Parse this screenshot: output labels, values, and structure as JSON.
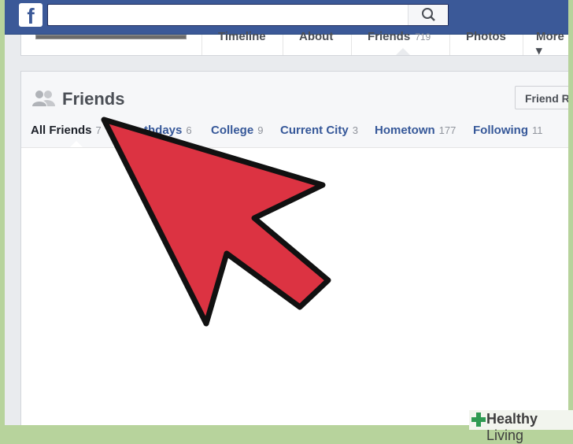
{
  "topbar": {
    "logo": "f",
    "search_placeholder": "",
    "search_icon": "search-icon"
  },
  "profile_nav": {
    "items": [
      {
        "label": "Timeline",
        "count": ""
      },
      {
        "label": "About",
        "count": ""
      },
      {
        "label": "Friends",
        "count": "719"
      },
      {
        "label": "Photos",
        "count": ""
      },
      {
        "label": "More",
        "count": ""
      }
    ]
  },
  "friends_panel": {
    "title": "Friends",
    "friend_requests_button": "Friend R",
    "tabs": [
      {
        "label": "All Friends",
        "count": "7"
      },
      {
        "label": "thdays",
        "count": "6"
      },
      {
        "label": "College",
        "count": "9"
      },
      {
        "label": "Current City",
        "count": "3"
      },
      {
        "label": "Hometown",
        "count": "177"
      },
      {
        "label": "Following",
        "count": "11"
      }
    ]
  },
  "annotation": {
    "arrow_color": "#dc3342",
    "icon": "arrow-pointer-icon"
  },
  "watermark": {
    "text_bold": "Healthy",
    "text_regular": " Living"
  },
  "colors": {
    "facebook_blue": "#3b5998",
    "link_blue": "#365899",
    "frame_green": "#b7d39c"
  }
}
